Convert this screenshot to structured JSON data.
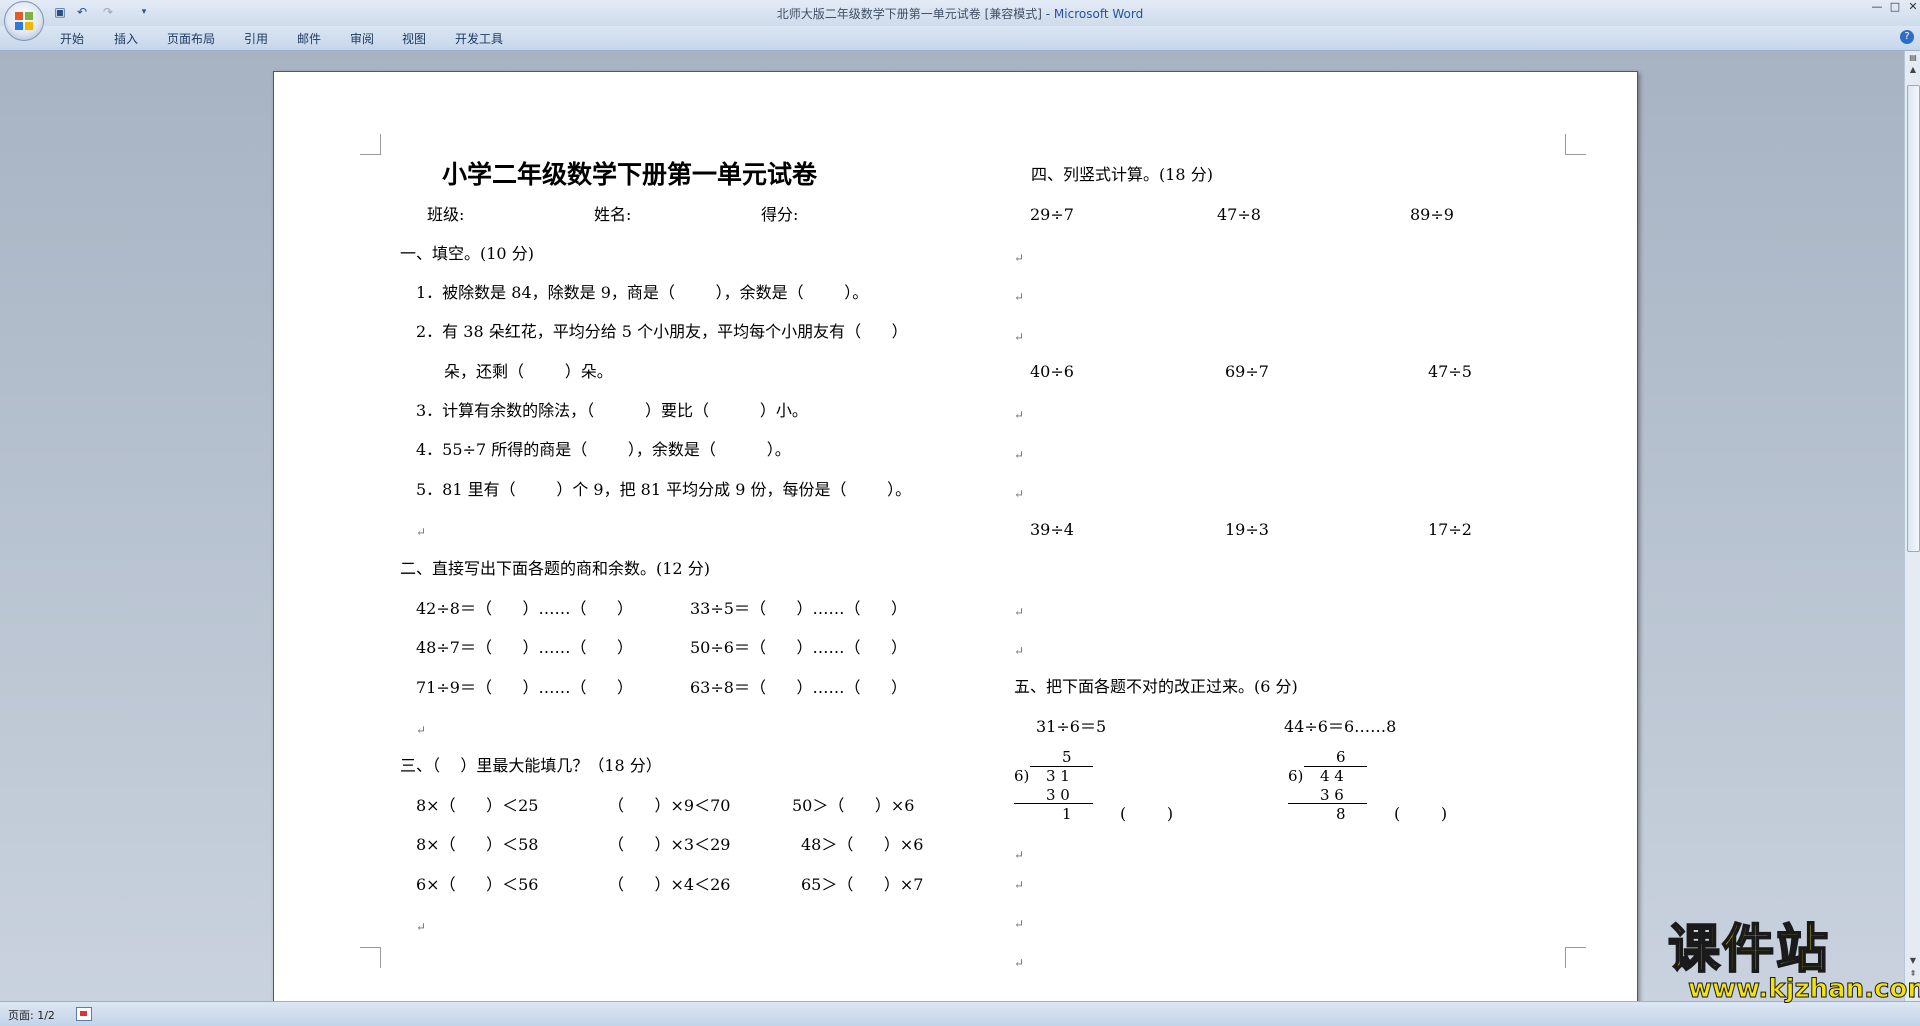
{
  "window": {
    "title": "北师大版二年级数学下册第一单元试卷 [兼容模式]",
    "app_suffix": " - Microsoft Word",
    "controls": [
      "—",
      "□",
      "✕"
    ]
  },
  "quick_access": [
    "save-icon",
    "undo-icon",
    "redo-icon",
    "customize-icon"
  ],
  "ribbon": {
    "tabs": [
      "开始",
      "插入",
      "页面布局",
      "引用",
      "邮件",
      "审阅",
      "视图",
      "开发工具"
    ],
    "help": "?"
  },
  "status": {
    "page": "页面: 1/2"
  },
  "watermark": {
    "title": "课件站",
    "url": "www.kjzhan.com"
  },
  "doc": {
    "title": "小学二年级数学下册第一单元试卷",
    "info": {
      "class": "班级:",
      "name": "姓名:",
      "score": "得分:"
    },
    "s1": {
      "heading": "一、填空。(10 分)",
      "items": [
        "1．被除数是 84，除数是 9，商是（        ），余数是（        ）。",
        "2．有 38 朵红花，平均分给 5 个小朋友，平均每个小朋友有（      ）",
        "朵，还剩（        ）朵。",
        "3．计算有余数的除法，（          ）要比（          ）小。",
        "4．55÷7 所得的商是（        ），余数是（          ）。",
        "5．81 里有（        ）个 9，把 81 平均分成 9 份，每份是（        ）。"
      ]
    },
    "s2": {
      "heading": "二、直接写出下面各题的商和余数。(12 分)",
      "left": [
        "42÷8＝（      ）……（      ）",
        "48÷7＝（      ）……（      ）",
        "71÷9＝（      ）……（      ）"
      ],
      "right": [
        "33÷5＝（      ）……（      ）",
        "50÷6＝（      ）……（      ）",
        "63÷8＝（      ）……（      ）"
      ]
    },
    "s3": {
      "heading": "三、（    ）里最大能填几？（18 分）",
      "rows": [
        [
          "8×（      ）＜25",
          "（      ）×9＜70",
          "50＞（      ）×6"
        ],
        [
          "8×（      ）＜58",
          "（      ）×3＜29",
          "48＞（      ）×6"
        ],
        [
          "6×（      ）＜56",
          "（      ）×4＜26",
          "65＞（      ）×7"
        ]
      ]
    },
    "s4": {
      "heading": "四、列竖式计算。(18 分)",
      "rows": [
        [
          "29÷7",
          "47÷8",
          "89÷9"
        ],
        [
          "40÷6",
          "69÷7",
          "47÷5"
        ],
        [
          "39÷4",
          "19÷3",
          "17÷2"
        ]
      ]
    },
    "s5": {
      "heading": "五、把下面各题不对的改正过来。(6 分)",
      "p1": {
        "eq": "31÷6＝5",
        "quotient": "5",
        "divisor": "6)",
        "dividend": "3 1",
        "product": "3 0",
        "remainder": "1",
        "blank": "(        )"
      },
      "p2": {
        "eq": "44÷6＝6……8",
        "quotient": "6",
        "divisor": "6)",
        "dividend": "4 4",
        "product": "3 6",
        "remainder": "8",
        "blank": "(        )"
      }
    },
    "para_mark": "↵"
  }
}
